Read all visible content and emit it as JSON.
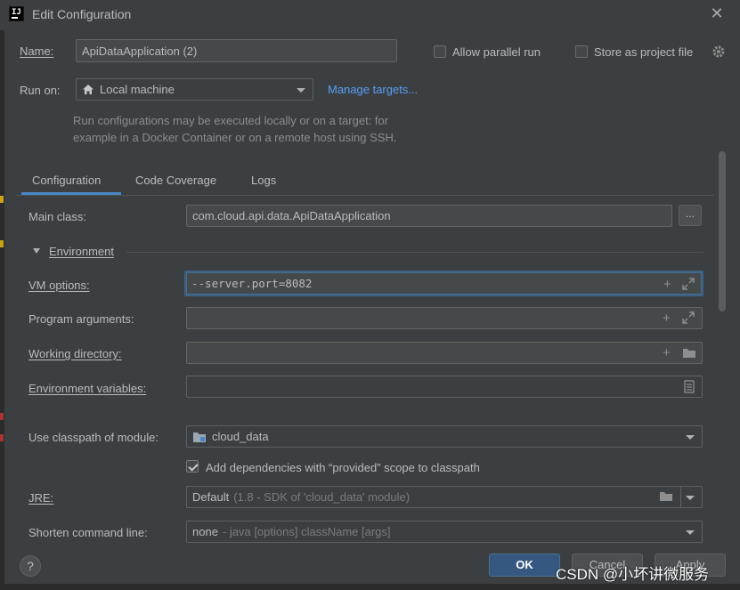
{
  "window": {
    "title": "Edit Configuration",
    "close_glyph": "✕"
  },
  "header": {
    "name_label": "Name:",
    "name_value": "ApiDataApplication (2)",
    "allow_parallel_label": "Allow parallel run",
    "allow_parallel_checked": false,
    "store_project_label": "Store as project file",
    "store_project_checked": false,
    "run_on_label": "Run on:",
    "run_on_value": "Local machine",
    "manage_targets": "Manage targets...",
    "hint_line1": "Run configurations may be executed locally or on a target: for",
    "hint_line2": "example in a Docker Container or on a remote host using SSH."
  },
  "tabs": [
    {
      "label": "Configuration",
      "active": true
    },
    {
      "label": "Code Coverage",
      "active": false
    },
    {
      "label": "Logs",
      "active": false
    }
  ],
  "form": {
    "main_class_label": "Main class:",
    "main_class_value": "com.cloud.api.data.ApiDataApplication",
    "browse_label": "...",
    "environment_section": "Environment",
    "vm_options_label": "VM options:",
    "vm_options_value": "--server.port=8082",
    "program_args_label": "Program arguments:",
    "program_args_value": "",
    "working_dir_label": "Working directory:",
    "working_dir_value": "",
    "env_vars_label": "Environment variables:",
    "env_vars_value": "",
    "classpath_label": "Use classpath of module:",
    "classpath_value": "cloud_data",
    "add_deps_label": "Add dependencies with “provided” scope to classpath",
    "add_deps_checked": true,
    "jre_label": "JRE:",
    "jre_value": "Default",
    "jre_detail": "(1.8 - SDK of 'cloud_data' module)",
    "shorten_label": "Shorten command line:",
    "shorten_value": "none",
    "shorten_detail": "- java [options] className [args]"
  },
  "footer": {
    "help": "?",
    "ok": "OK",
    "cancel": "Cancel",
    "apply": "Apply"
  },
  "watermark": "CSDN @小坏讲微服务",
  "colors": {
    "accent": "#4a88c7",
    "link": "#589df6",
    "background": "#3c3f41",
    "ok_button": "#365880"
  }
}
